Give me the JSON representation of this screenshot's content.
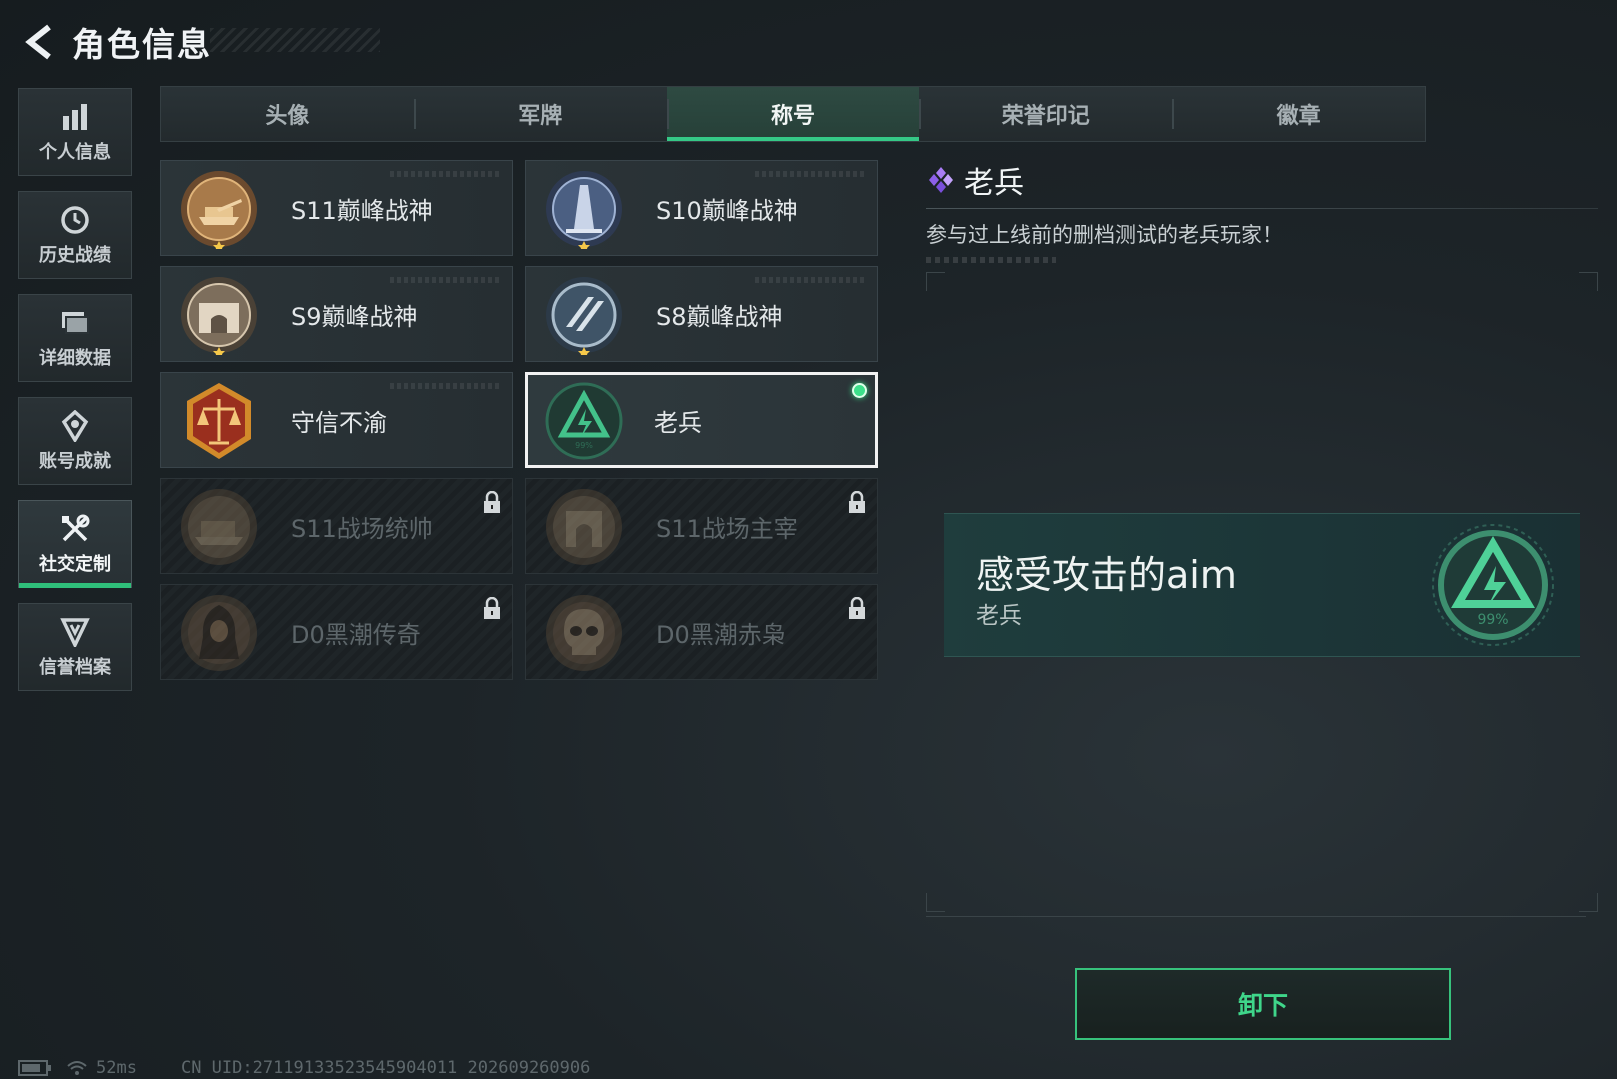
{
  "header": {
    "title": "角色信息",
    "back_icon": "back-arrow-icon"
  },
  "sidebar": {
    "items": [
      {
        "label": "个人信息",
        "icon": "bar-chart-icon",
        "active": false
      },
      {
        "label": "历史战绩",
        "icon": "clock-icon",
        "active": false
      },
      {
        "label": "详细数据",
        "icon": "folder-icon",
        "active": false
      },
      {
        "label": "账号成就",
        "icon": "medal-icon",
        "active": false
      },
      {
        "label": "社交定制",
        "icon": "tools-icon",
        "active": true
      },
      {
        "label": "信誉档案",
        "icon": "shield-icon",
        "active": false
      }
    ]
  },
  "tabs": [
    {
      "label": "头像",
      "active": false
    },
    {
      "label": "军牌",
      "active": false
    },
    {
      "label": "称号",
      "active": true
    },
    {
      "label": "荣誉印记",
      "active": false
    },
    {
      "label": "徽章",
      "active": false
    }
  ],
  "titles": [
    {
      "label": "S11巅峰战神",
      "icon": "tank-emblem-icon",
      "state": "owned"
    },
    {
      "label": "S10巅峰战神",
      "icon": "tower-emblem-icon",
      "state": "owned"
    },
    {
      "label": "S9巅峰战神",
      "icon": "fortress-emblem-icon",
      "state": "owned"
    },
    {
      "label": "S8巅峰战神",
      "icon": "stripes-emblem-icon",
      "state": "owned"
    },
    {
      "label": "守信不渝",
      "icon": "scales-emblem-icon",
      "state": "owned"
    },
    {
      "label": "老兵",
      "icon": "veteran-emblem-icon",
      "state": "equipped"
    },
    {
      "label": "S11战场统帅",
      "icon": "vehicle-emblem-icon",
      "state": "locked"
    },
    {
      "label": "S11战场主宰",
      "icon": "arch-emblem-icon",
      "state": "locked"
    },
    {
      "label": "D0黑潮传奇",
      "icon": "hooded-figure-emblem-icon",
      "state": "locked"
    },
    {
      "label": "D0黑潮赤枭",
      "icon": "skull-emblem-icon",
      "state": "locked"
    }
  ],
  "detail": {
    "title": "老兵",
    "description": "参与过上线前的删档测试的老兵玩家！",
    "title_icon": "diamond-cluster-icon"
  },
  "preview": {
    "player_name": "感受攻击的aim",
    "title": "老兵",
    "emblem_text": "99%"
  },
  "actions": {
    "unequip_label": "卸下"
  },
  "status_bar": {
    "ping": "52ms",
    "uid": "CN UID:27119133523545904011 202609260906"
  },
  "colors": {
    "accent": "#35c987",
    "equipped_dot": "#3ce08a",
    "title_icon": "#9a6cf0"
  }
}
